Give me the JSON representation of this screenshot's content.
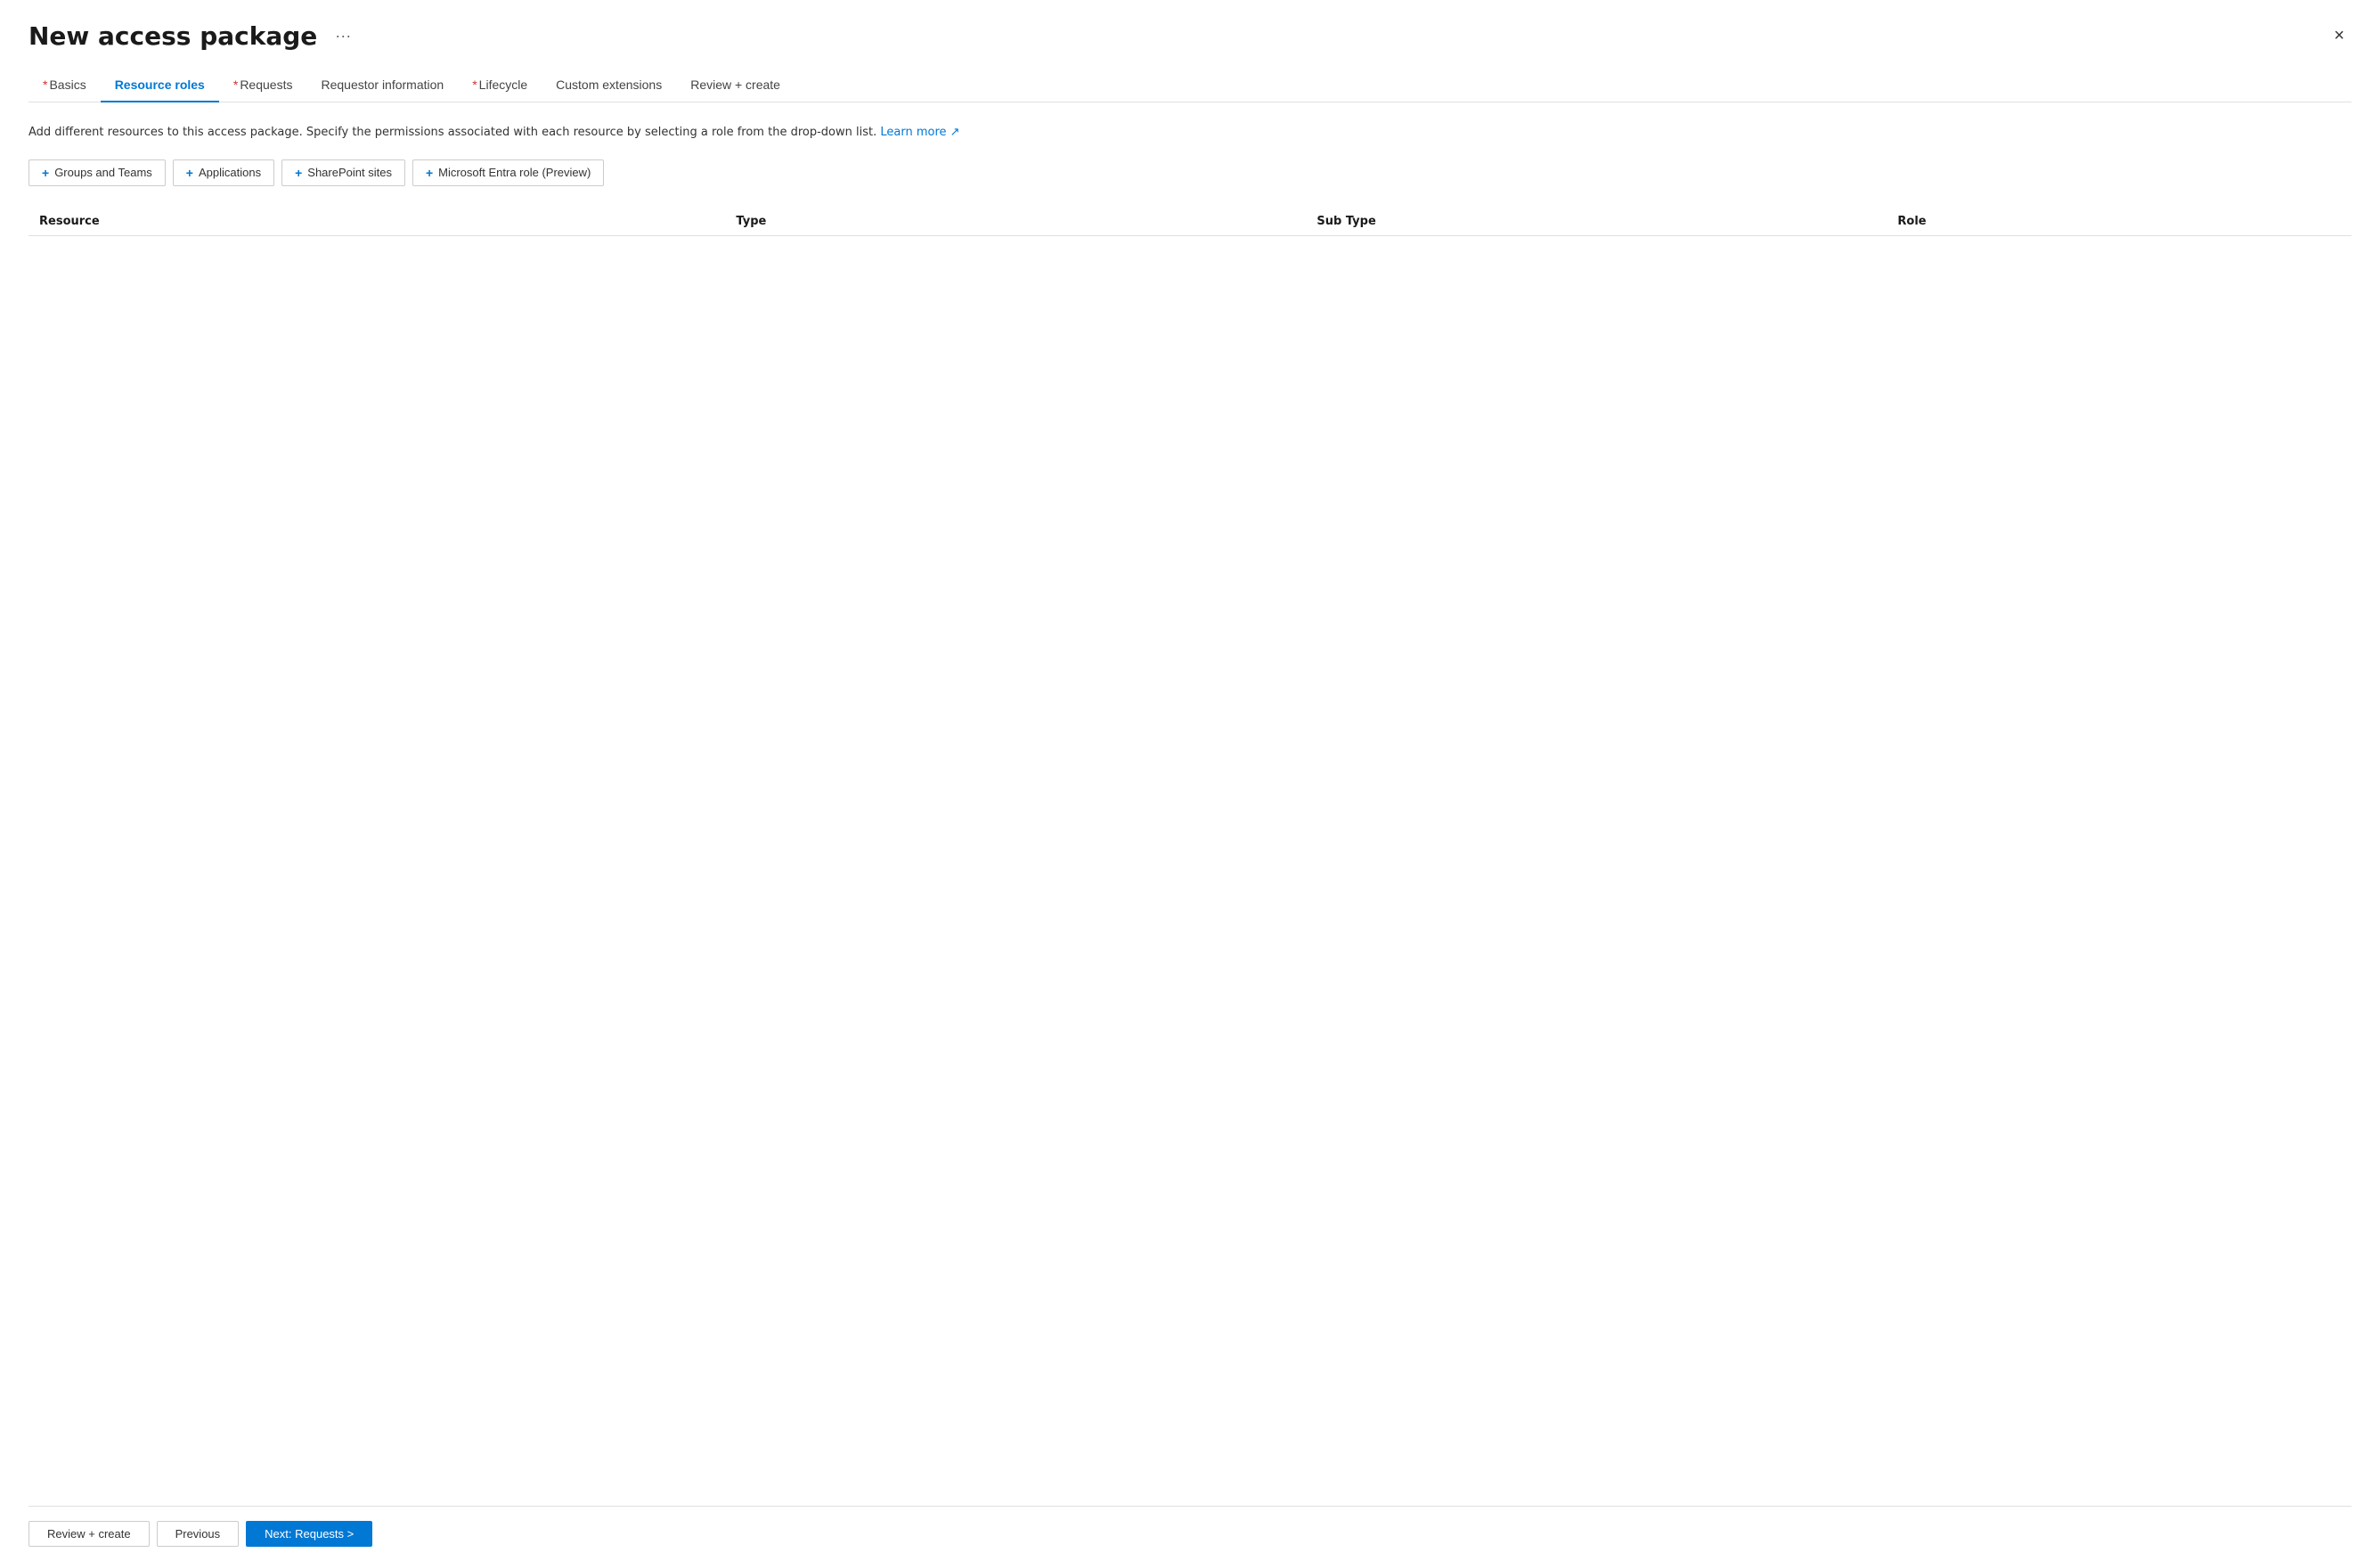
{
  "page": {
    "title": "New access package",
    "more_options_label": "···",
    "close_label": "×"
  },
  "tabs": [
    {
      "id": "basics",
      "label": "Basics",
      "required": true,
      "active": false
    },
    {
      "id": "resource-roles",
      "label": "Resource roles",
      "required": false,
      "active": true
    },
    {
      "id": "requests",
      "label": "Requests",
      "required": true,
      "active": false
    },
    {
      "id": "requestor-info",
      "label": "Requestor information",
      "required": false,
      "active": false
    },
    {
      "id": "lifecycle",
      "label": "Lifecycle",
      "required": true,
      "active": false
    },
    {
      "id": "custom-extensions",
      "label": "Custom extensions",
      "required": false,
      "active": false
    },
    {
      "id": "review-create",
      "label": "Review + create",
      "required": false,
      "active": false
    }
  ],
  "description": {
    "text": "Add different resources to this access package. Specify the permissions associated with each resource by selecting a role from the drop-down list.",
    "link_text": "Learn more",
    "link_icon": "↗"
  },
  "resource_buttons": [
    {
      "id": "groups-teams",
      "label": "Groups and Teams"
    },
    {
      "id": "applications",
      "label": "Applications"
    },
    {
      "id": "sharepoint-sites",
      "label": "SharePoint sites"
    },
    {
      "id": "entra-role",
      "label": "Microsoft Entra role (Preview)"
    }
  ],
  "table": {
    "columns": [
      {
        "id": "resource",
        "label": "Resource"
      },
      {
        "id": "type",
        "label": "Type"
      },
      {
        "id": "subtype",
        "label": "Sub Type"
      },
      {
        "id": "role",
        "label": "Role"
      }
    ],
    "rows": []
  },
  "footer": {
    "review_create_label": "Review + create",
    "previous_label": "Previous",
    "next_label": "Next: Requests >"
  },
  "colors": {
    "accent": "#0078d4",
    "required_star": "#d32f2f",
    "active_tab": "#0078d4"
  }
}
